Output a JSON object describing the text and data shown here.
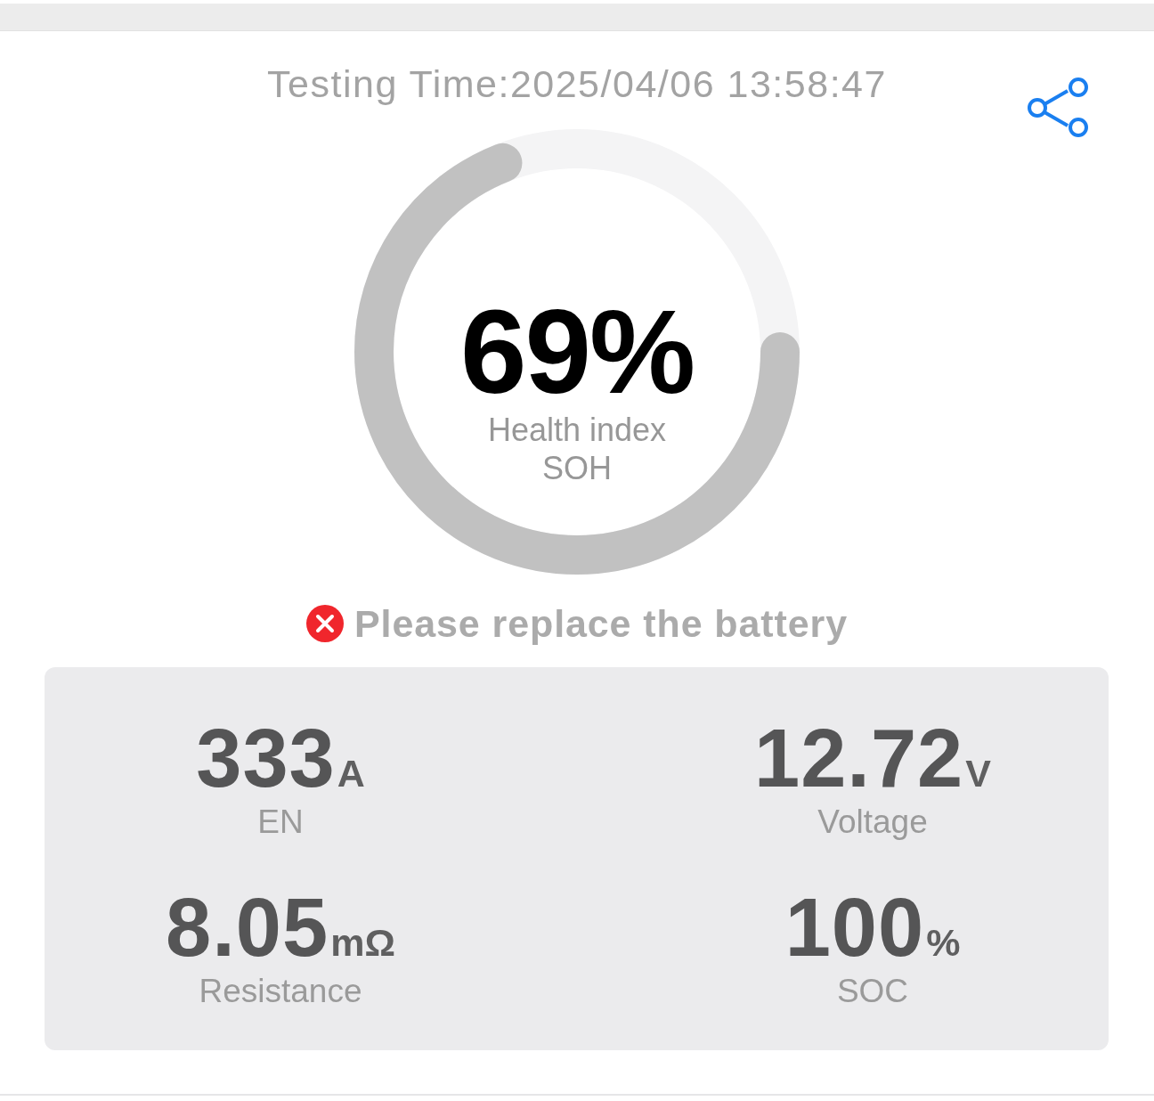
{
  "header": {
    "testing_time": "Testing Time:2025/04/06 13:58:47"
  },
  "gauge": {
    "value": "69%",
    "level": 0.69,
    "label": "Health index",
    "sublabel": "SOH"
  },
  "status": {
    "kind": "error",
    "message": "Please replace the battery"
  },
  "metrics": [
    {
      "value": "333",
      "unit": "A",
      "label": "EN"
    },
    {
      "value": "12.72",
      "unit": "V",
      "label": "Voltage"
    },
    {
      "value": "8.05",
      "unit": "mΩ",
      "label": "Resistance"
    },
    {
      "value": "100",
      "unit": "%",
      "label": "SOC"
    }
  ]
}
